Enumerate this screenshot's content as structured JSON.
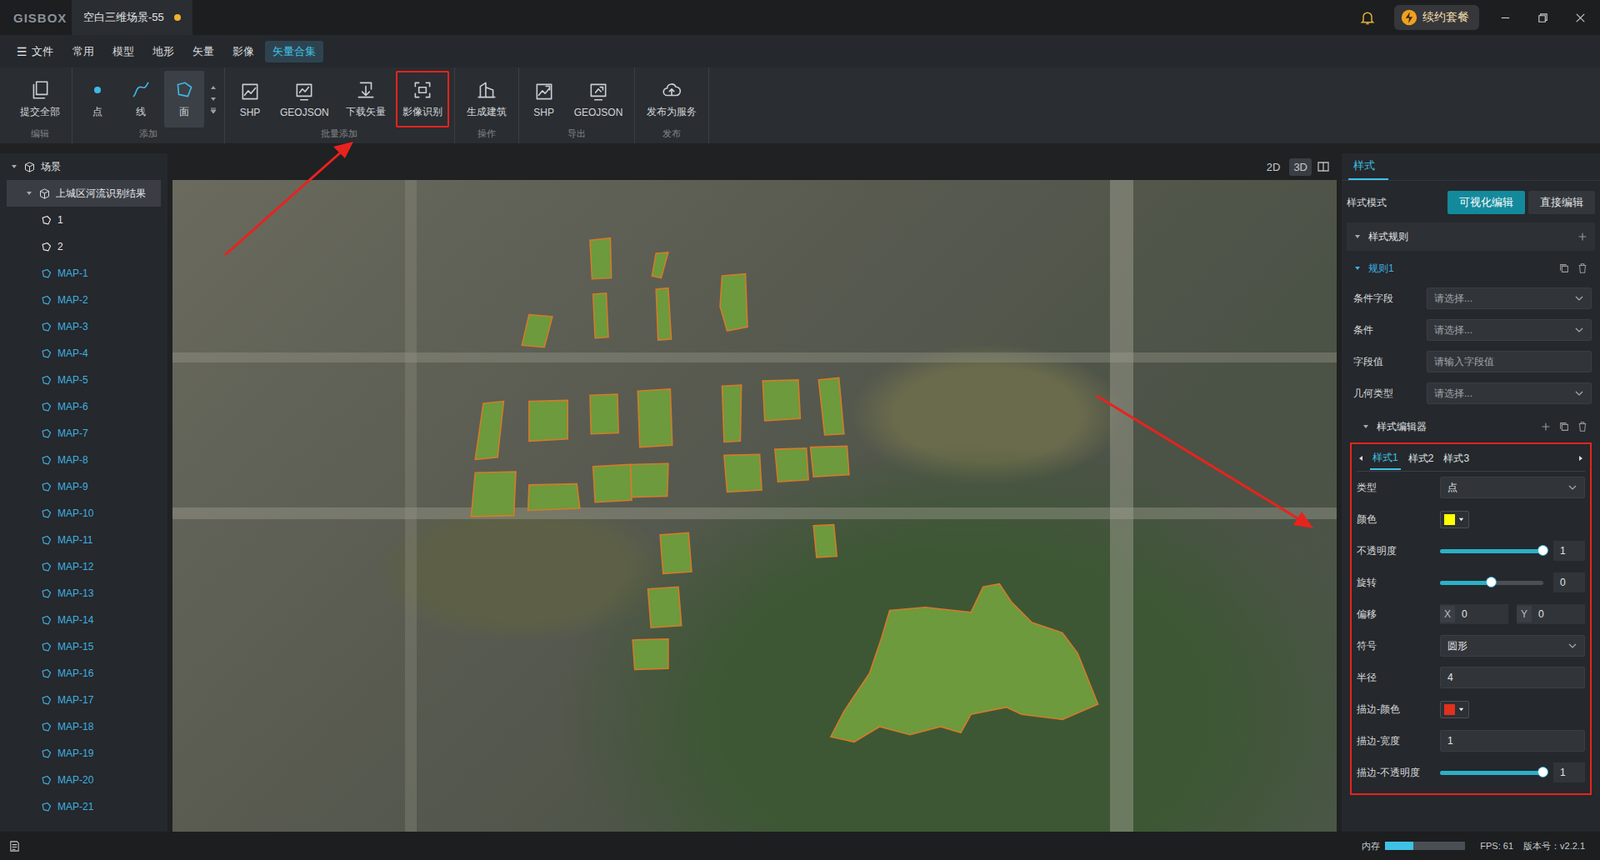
{
  "title_bar": {
    "logo": "GISBOX",
    "document_tab": {
      "title": "空白三维场景-55",
      "unsaved": true
    },
    "renew_button": "续约套餐"
  },
  "menu": {
    "file": {
      "icon": "☰",
      "label": "文件"
    },
    "tabs": [
      {
        "label": "常用",
        "selected": false
      },
      {
        "label": "模型",
        "selected": false
      },
      {
        "label": "地形",
        "selected": false
      },
      {
        "label": "矢量",
        "selected": false
      },
      {
        "label": "影像",
        "selected": false
      },
      {
        "label": "矢量合集",
        "selected": true
      }
    ]
  },
  "ribbon": [
    {
      "label": "编辑",
      "scroller": false,
      "buttons": [
        {
          "label": "提交全部",
          "kind": "submit",
          "selected": false,
          "highlighted": false
        }
      ]
    },
    {
      "label": "添加",
      "scroller": true,
      "buttons": [
        {
          "label": "点",
          "kind": "point",
          "selected": false,
          "highlighted": false
        },
        {
          "label": "线",
          "kind": "line",
          "selected": false,
          "highlighted": false
        },
        {
          "label": "面",
          "kind": "polygon",
          "selected": true,
          "highlighted": false
        }
      ]
    },
    {
      "label": "批量添加",
      "scroller": false,
      "buttons": [
        {
          "label": "SHP",
          "kind": "shp",
          "selected": false,
          "highlighted": false
        },
        {
          "label": "GEOJSON",
          "kind": "geojson",
          "selected": false,
          "highlighted": false
        },
        {
          "label": "下载矢量",
          "kind": "download",
          "selected": false,
          "highlighted": false
        },
        {
          "label": "影像识别",
          "kind": "recognize",
          "selected": false,
          "highlighted": true
        }
      ]
    },
    {
      "label": "操作",
      "scroller": false,
      "buttons": [
        {
          "label": "生成建筑",
          "kind": "building",
          "selected": false,
          "highlighted": false
        }
      ]
    },
    {
      "label": "导出",
      "scroller": false,
      "buttons": [
        {
          "label": "SHP",
          "kind": "export-shp",
          "selected": false,
          "highlighted": false
        },
        {
          "label": "GEOJSON",
          "kind": "export-geojson",
          "selected": false,
          "highlighted": false
        }
      ]
    },
    {
      "label": "发布",
      "scroller": false,
      "buttons": [
        {
          "label": "发布为服务",
          "kind": "publish",
          "selected": false,
          "highlighted": false
        }
      ]
    }
  ],
  "scene_tree": {
    "root": {
      "label": "场景",
      "expanded": true
    },
    "layer": {
      "label": "上城区河流识别结果",
      "expanded": true,
      "selected": true
    },
    "items": [
      {
        "label": "1",
        "color": "#e6e6e6"
      },
      {
        "label": "2",
        "color": "#e6e6e6"
      },
      {
        "label": "MAP-1",
        "color": "#3fb0e0"
      },
      {
        "label": "MAP-2",
        "color": "#3fb0e0"
      },
      {
        "label": "MAP-3",
        "color": "#3fb0e0"
      },
      {
        "label": "MAP-4",
        "color": "#3fb0e0"
      },
      {
        "label": "MAP-5",
        "color": "#3fb0e0"
      },
      {
        "label": "MAP-6",
        "color": "#3fb0e0"
      },
      {
        "label": "MAP-7",
        "color": "#3fb0e0"
      },
      {
        "label": "MAP-8",
        "color": "#3fb0e0"
      },
      {
        "label": "MAP-9",
        "color": "#3fb0e0"
      },
      {
        "label": "MAP-10",
        "color": "#3fb0e0"
      },
      {
        "label": "MAP-11",
        "color": "#3fb0e0"
      },
      {
        "label": "MAP-12",
        "color": "#3fb0e0"
      },
      {
        "label": "MAP-13",
        "color": "#3fb0e0"
      },
      {
        "label": "MAP-14",
        "color": "#3fb0e0"
      },
      {
        "label": "MAP-15",
        "color": "#3fb0e0"
      },
      {
        "label": "MAP-16",
        "color": "#3fb0e0"
      },
      {
        "label": "MAP-17",
        "color": "#3fb0e0"
      },
      {
        "label": "MAP-18",
        "color": "#3fb0e0"
      },
      {
        "label": "MAP-19",
        "color": "#3fb0e0"
      },
      {
        "label": "MAP-20",
        "color": "#3fb0e0"
      },
      {
        "label": "MAP-21",
        "color": "#3fb0e0"
      }
    ]
  },
  "view_modes": [
    {
      "label": "2D",
      "selected": false
    },
    {
      "label": "3D",
      "selected": true
    }
  ],
  "right_panel": {
    "tabs": [
      {
        "label": "样式",
        "selected": true
      }
    ],
    "style_mode": {
      "label": "样式模式",
      "options": [
        {
          "label": "可视化编辑",
          "selected": true
        },
        {
          "label": "直接编辑",
          "selected": false
        }
      ]
    },
    "rules_section": {
      "title": "样式规则",
      "expanded": true
    },
    "rule": {
      "title": "规则1",
      "expanded": true,
      "fields": [
        {
          "label": "条件字段",
          "kind": "select",
          "placeholder": "请选择..."
        },
        {
          "label": "条件",
          "kind": "select",
          "placeholder": "请选择..."
        },
        {
          "label": "字段值",
          "kind": "input",
          "placeholder": "请输入字段值"
        },
        {
          "label": "几何类型",
          "kind": "select",
          "placeholder": "请选择..."
        }
      ]
    },
    "style_editor": {
      "title": "样式编辑器",
      "expanded": true,
      "highlighted": true,
      "tabs": [
        {
          "label": "样式1",
          "selected": true
        },
        {
          "label": "样式2",
          "selected": false
        },
        {
          "label": "样式3",
          "selected": false
        }
      ],
      "fields": [
        {
          "label": "类型",
          "kind": "select",
          "value": "点"
        },
        {
          "label": "颜色",
          "kind": "color",
          "color": "#ffff00"
        },
        {
          "label": "不透明度",
          "kind": "slider",
          "level": 1,
          "value": "1"
        },
        {
          "label": "旋转",
          "kind": "slider",
          "level": 0.5,
          "value": "0"
        },
        {
          "label": "偏移",
          "kind": "offset",
          "x_label": "X",
          "x": "0",
          "y_label": "Y",
          "y": "0"
        },
        {
          "label": "符号",
          "kind": "select",
          "value": "圆形"
        },
        {
          "label": "半径",
          "kind": "input",
          "value": "4"
        },
        {
          "label": "描边-颜色",
          "kind": "color",
          "color": "#e0301e"
        },
        {
          "label": "描边-宽度",
          "kind": "input",
          "value": "1"
        },
        {
          "label": "描边-不透明度",
          "kind": "slider",
          "level": 1,
          "value": "1"
        }
      ]
    }
  },
  "status_bar": {
    "memory": {
      "label": "内存",
      "level": 0.35
    },
    "fps": "FPS: 61",
    "version": "版本号：v2.2.1"
  }
}
